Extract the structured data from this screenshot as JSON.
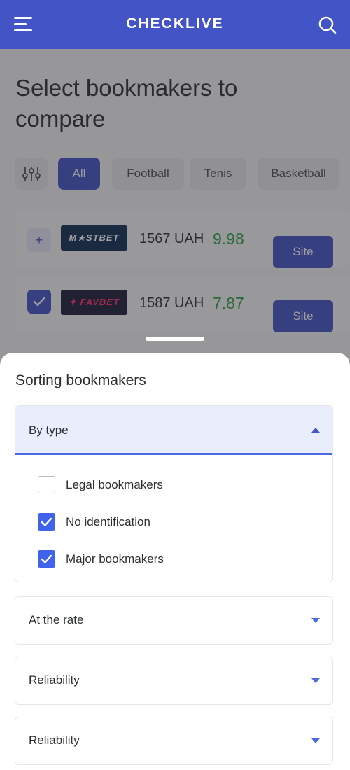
{
  "header": {
    "brand": "CHECKLIVE"
  },
  "page": {
    "title": "Select bookmakers to compare"
  },
  "filters": {
    "chips": [
      {
        "label": "All",
        "active": true
      },
      {
        "label": "Football",
        "active": false
      },
      {
        "label": "Tenis",
        "active": false
      },
      {
        "label": "Basketball",
        "active": false
      }
    ]
  },
  "bookmakers": [
    {
      "logo": "M★STBET",
      "price": "1567 UAH",
      "odds": "9.98",
      "selected": false,
      "action": "Site"
    },
    {
      "logo": "✦ FAVBET",
      "price": "1587 UAH",
      "odds": "7.87",
      "selected": true,
      "action": "Site"
    }
  ],
  "sheet": {
    "title": "Sorting bookmakers",
    "sections": [
      {
        "label": "By type",
        "expanded": true,
        "options": [
          {
            "label": "Legal bookmakers",
            "checked": false
          },
          {
            "label": "No identification",
            "checked": true
          },
          {
            "label": "Major bookmakers",
            "checked": true
          }
        ]
      },
      {
        "label": "At the rate",
        "expanded": false
      },
      {
        "label": "Reliability",
        "expanded": false
      },
      {
        "label": "Reliability",
        "expanded": false
      }
    ]
  },
  "colors": {
    "primary": "#4355c6",
    "odds_green": "#2f9e45",
    "checkbox_blue": "#3f63ec",
    "accordion_active_bg": "#eaeefc"
  }
}
